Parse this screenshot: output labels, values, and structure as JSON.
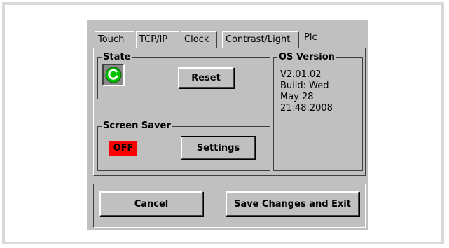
{
  "tabs": [
    "Touch",
    "TCP/IP",
    "Clock",
    "Contrast/Light",
    "Plc"
  ],
  "state": {
    "legend": "State",
    "reset_label": "Reset",
    "indicator_color": "#00c000"
  },
  "os": {
    "legend": "OS Version",
    "text": "V2.01.02\nBuild: Wed\nMay 28\n21:48:2008"
  },
  "screensaver": {
    "legend": "Screen Saver",
    "status": "OFF",
    "status_color": "#ff0000",
    "settings_label": "Settings"
  },
  "footer": {
    "cancel_label": "Cancel",
    "save_label": "Save Changes and Exit"
  }
}
